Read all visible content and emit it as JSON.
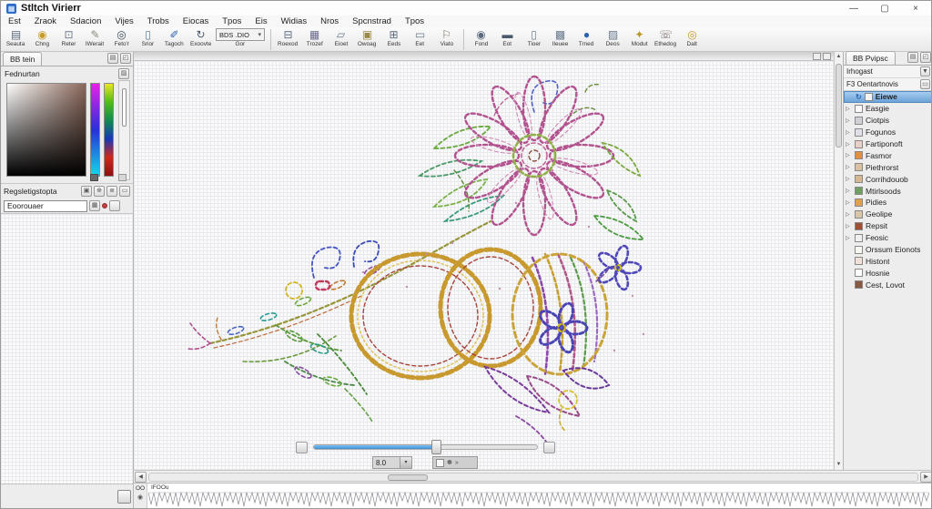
{
  "window": {
    "title": "Stltch Virierr",
    "minimize": "—",
    "maximize": "▢",
    "close": "×"
  },
  "menu": [
    "Est",
    "Zraok",
    "Sdacion",
    "Vijes",
    "Trobs",
    "Eiocas",
    "Tpos",
    "Eis",
    "Widias",
    "Nros",
    "Spcnstrad",
    "Tpos"
  ],
  "toolbar": {
    "group1": [
      {
        "label": "Seauta",
        "icon": "new-design-icon",
        "glyph": "▤",
        "color": "#5a6a7e"
      },
      {
        "label": "Chng",
        "icon": "open-search-icon",
        "glyph": "◉",
        "color": "#c79a2a"
      },
      {
        "label": "Reter",
        "icon": "select-region-icon",
        "glyph": "⊡",
        "color": "#6a7a8e"
      },
      {
        "label": "IWerait",
        "icon": "edit-pencil-icon",
        "glyph": "✎",
        "color": "#8a8a7a"
      },
      {
        "label": "Feto'r",
        "icon": "target-point-icon",
        "glyph": "◎",
        "color": "#3a4a5a"
      },
      {
        "label": "Srior",
        "icon": "save-design-icon",
        "glyph": "▯",
        "color": "#5a7a9a"
      },
      {
        "label": "Tagoch",
        "icon": "pen-tool-icon",
        "glyph": "✐",
        "color": "#2a62b0"
      },
      {
        "label": "Exoovte",
        "icon": "rotate-icon",
        "glyph": "↻",
        "color": "#4a5a6a"
      }
    ],
    "dropdown": {
      "value": "BDS .DIO",
      "arrow": "▾",
      "label": "Gor"
    },
    "group2": [
      {
        "label": "Roexod",
        "icon": "print-icon",
        "glyph": "⊟",
        "color": "#5a6a7e"
      },
      {
        "label": "Trozef",
        "icon": "machine-icon",
        "glyph": "▦",
        "color": "#6a6a8e"
      },
      {
        "label": "Eioet",
        "icon": "hoop-icon",
        "glyph": "▱",
        "color": "#6a7a8e"
      },
      {
        "label": "Owoag",
        "icon": "image-icon",
        "glyph": "▣",
        "color": "#9a8a4a"
      },
      {
        "label": "Eeds",
        "icon": "grid-icon",
        "glyph": "⊞",
        "color": "#5a6a7e"
      },
      {
        "label": "Eet",
        "icon": "frame-icon",
        "glyph": "▭",
        "color": "#6a7a8e"
      },
      {
        "label": "Viato",
        "icon": "flag-icon",
        "glyph": "⚐",
        "color": "#7a6a5a"
      }
    ],
    "group3": [
      {
        "label": "Fond",
        "icon": "center-point-icon",
        "glyph": "◉",
        "color": "#5a6a7e"
      },
      {
        "label": "Eot",
        "icon": "monitor-icon",
        "glyph": "▬",
        "color": "#4a5a6a"
      },
      {
        "label": "Tioer",
        "icon": "page-icon",
        "glyph": "▯",
        "color": "#6a7a8e"
      },
      {
        "label": "Ileuee",
        "icon": "layers-icon",
        "glyph": "▩",
        "color": "#6a7a8e"
      },
      {
        "label": "Trned",
        "icon": "comment-icon",
        "glyph": "●",
        "color": "#2a62b0"
      },
      {
        "label": "Deos",
        "icon": "copies-icon",
        "glyph": "▨",
        "color": "#6a7a8e"
      },
      {
        "label": "Modut",
        "icon": "tools-icon",
        "glyph": "✦",
        "color": "#b8962a"
      },
      {
        "label": "Ethedog",
        "icon": "phone-icon",
        "glyph": "☏",
        "color": "#7a6a6a"
      },
      {
        "label": "Dalt",
        "icon": "zoom-icon",
        "glyph": "◎",
        "color": "#c79a2a"
      }
    ]
  },
  "left_panel": {
    "tab": "BB tein",
    "section_title": "Fednurtan",
    "controls_label": "Regsletigstopta",
    "field_value": "Eoorouaer",
    "picker": {
      "base_color": "#8a675a",
      "strip1": [
        "#e820e8",
        "#2830d8",
        "#14d8e8"
      ],
      "strip2": [
        "#e8e620",
        "#50bc18",
        "#128a50",
        "#1838b8",
        "#d02818",
        "#8c1010"
      ]
    }
  },
  "canvas": {
    "slider": {
      "value": "8.0",
      "position_pct": 55
    }
  },
  "right_panel": {
    "tab": "BB Pvipsc",
    "filter_label": "Irhogast",
    "root_label": "F3 Oentartnovis",
    "items": [
      {
        "label": "Eiewe",
        "selected": true,
        "chevron": false,
        "icon_color": "#f4f4f4"
      },
      {
        "label": "Easgie",
        "chevron": true,
        "icon_color": "#fafafa"
      },
      {
        "label": "Ciotpis",
        "chevron": true,
        "icon_color": "#d0d0d8"
      },
      {
        "label": "Fogunos",
        "chevron": true,
        "icon_color": "#e0e0e8"
      },
      {
        "label": "Fartiponoft",
        "chevron": true,
        "icon_color": "#e8d0c8"
      },
      {
        "label": "Fasmor",
        "chevron": true,
        "icon_color": "#e09040"
      },
      {
        "label": "Piethrorst",
        "chevron": true,
        "icon_color": "#d8c0a0"
      },
      {
        "label": "Corrihdouob",
        "chevron": true,
        "icon_color": "#d8b890"
      },
      {
        "label": "Mtirlsoods",
        "chevron": true,
        "icon_color": "#70a060"
      },
      {
        "label": "Pidies",
        "chevron": true,
        "icon_color": "#e0a050"
      },
      {
        "label": "Geolipe",
        "chevron": true,
        "icon_color": "#d8c8a8"
      },
      {
        "label": "Repsit",
        "chevron": true,
        "icon_color": "#a05030"
      },
      {
        "label": "Feosic",
        "chevron": true,
        "icon_color": "#f0f0f0"
      },
      {
        "label": "Orssum Eionots",
        "chevron": false,
        "icon_color": "#f8f8f0"
      },
      {
        "label": "Histont",
        "chevron": false,
        "icon_color": "#f0e0d8"
      },
      {
        "label": "Hosnie",
        "chevron": false,
        "icon_color": "#ffffff"
      },
      {
        "label": "Cest, Lovot",
        "chevron": false,
        "icon_color": "#8a5a40"
      }
    ]
  },
  "timeline": {
    "counter": "OO",
    "ruler_label": "IFOOu"
  },
  "icons": {
    "chevron": "▷",
    "refresh": "↻",
    "up": "▲",
    "down": "▼",
    "left": "◀",
    "right": "▶",
    "panel_menu": "▤",
    "panel_float": "◰",
    "small_grid": "▣",
    "small_plus": "⊕",
    "small_lines": "≣",
    "small_box": "▭",
    "swatch": "▨",
    "record": "◉",
    "aux1": "✽",
    "aux2": "»",
    "dropdown_arrow": "▾",
    "field_btn": "▦",
    "logo": "▦"
  }
}
